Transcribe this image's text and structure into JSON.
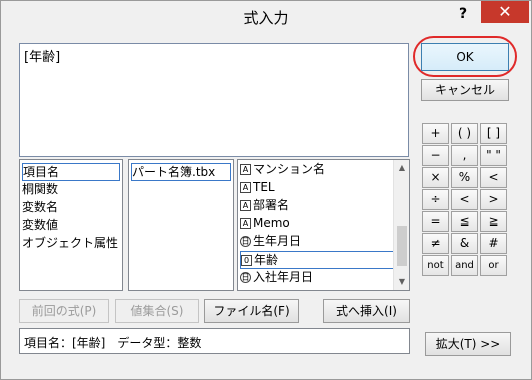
{
  "window": {
    "title": "式入力",
    "help_label": "?",
    "close_label": "✕"
  },
  "expression": {
    "value": "[年齢]"
  },
  "buttons": {
    "ok": "OK",
    "cancel": "キャンセル"
  },
  "keypad": [
    [
      "+",
      "( )",
      "[ ]"
    ],
    [
      "−",
      ",",
      "\" \""
    ],
    [
      "×",
      "%",
      "<"
    ],
    [
      "÷",
      "<",
      ">"
    ],
    [
      "=",
      "≦",
      "≧"
    ],
    [
      "≠",
      "&",
      "#"
    ],
    [
      "not",
      "and",
      "or"
    ]
  ],
  "list1": {
    "items": [
      "項目名",
      "桐関数",
      "変数名",
      "変数値",
      "オブジェクト属性"
    ]
  },
  "list2": {
    "items": [
      "パート名簿.tbx"
    ]
  },
  "list3": {
    "items": [
      {
        "icon": "A",
        "label": "マンション名"
      },
      {
        "icon": "A",
        "label": "TEL"
      },
      {
        "icon": "A",
        "label": "部署名"
      },
      {
        "icon": "A",
        "label": "Memo"
      },
      {
        "icon": "日",
        "label": "生年月日"
      },
      {
        "icon": "0",
        "label": "年齢"
      },
      {
        "icon": "日",
        "label": "入社年月日"
      }
    ]
  },
  "actions": {
    "prev": "前回の式(P)",
    "valset": "値集合(S)",
    "file": "ファイル名(F)",
    "insert": "式へ挿入(I)"
  },
  "status": {
    "text": "項目名：[年齢]　データ型：整数"
  },
  "expand": {
    "label": "拡大(T) >>"
  }
}
